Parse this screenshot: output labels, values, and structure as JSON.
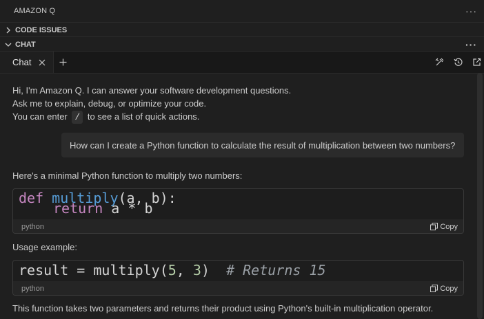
{
  "panel": {
    "title": "AMAZON Q"
  },
  "sections": [
    {
      "label": "CODE ISSUES",
      "expanded": false
    },
    {
      "label": "CHAT",
      "expanded": true
    }
  ],
  "tabbar": {
    "tab_label": "Chat",
    "icons": [
      "tools-icon",
      "history-icon",
      "open-in-editor-icon"
    ]
  },
  "chat": {
    "intro": {
      "line1": "Hi, I'm Amazon Q. I can answer your software development questions.",
      "line2": "Ask me to explain, debug, or optimize your code.",
      "line3_pre": "You can enter",
      "line3_key": "/",
      "line3_post": "to see a list of quick actions."
    },
    "user_message": "How can I create a Python function to calculate the result of multiplication between two numbers?",
    "answer": {
      "intro": "Here's a minimal Python function to multiply two numbers:",
      "code1": {
        "line1": {
          "kw": "def",
          "fn": "multiply",
          "rest": "(a, b):"
        },
        "line2": {
          "kw": "return",
          "rest": "a * b"
        },
        "language": "python",
        "copy_label": "Copy"
      },
      "usage_label": "Usage example:",
      "code2": {
        "pre": "result = multiply(",
        "n1": "5",
        "sep": ", ",
        "n2": "3",
        "post": ")  ",
        "comment": "# Returns 15",
        "language": "python",
        "copy_label": "Copy"
      },
      "closing": "This function takes two parameters and returns their product using Python's built-in multiplication operator."
    }
  },
  "colors": {
    "background": "#1f1f1f",
    "keyword": "#c586c0",
    "function": "#569cd6",
    "number": "#b5cea8"
  }
}
